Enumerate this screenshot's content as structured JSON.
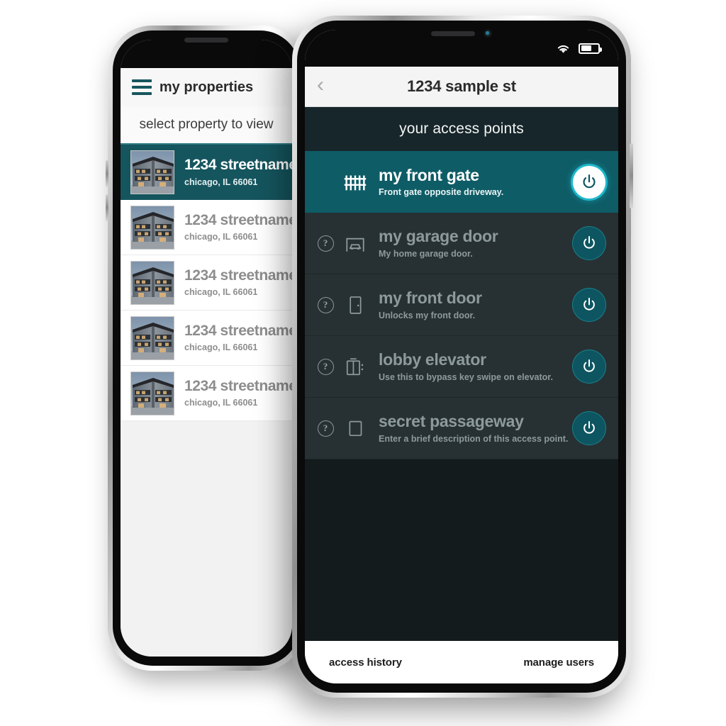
{
  "front_phone": {
    "status_bar": {
      "wifi_icon": "wifi-icon",
      "battery_icon": "battery-icon",
      "battery_percent": 65
    },
    "nav": {
      "back_icon": "chevron-left-icon",
      "title": "1234 sample st"
    },
    "subheader": "your access points",
    "access_points": [
      {
        "name": "my front gate",
        "description": "Front gate opposite driveway.",
        "icon": "gate-fence-icon",
        "active": true,
        "has_help": false,
        "power_icon": "power-icon",
        "power_on": true
      },
      {
        "name": "my garage door",
        "description": "My home garage door.",
        "icon": "garage-door-icon",
        "active": false,
        "has_help": true,
        "help_icon": "question-mark-icon",
        "power_icon": "power-icon",
        "power_on": false
      },
      {
        "name": "my front door",
        "description": "Unlocks my front door.",
        "icon": "door-icon",
        "active": false,
        "has_help": true,
        "help_icon": "question-mark-icon",
        "power_icon": "power-icon",
        "power_on": false
      },
      {
        "name": "lobby elevator",
        "description": "Use this to bypass key swipe on elevator.",
        "icon": "elevator-icon",
        "active": false,
        "has_help": true,
        "help_icon": "question-mark-icon",
        "power_icon": "power-icon",
        "power_on": false
      },
      {
        "name": "secret passageway",
        "description": "Enter a brief description of this access point.",
        "icon": "blank-square-icon",
        "active": false,
        "has_help": true,
        "help_icon": "question-mark-icon",
        "power_icon": "power-icon",
        "power_on": false
      }
    ],
    "tabbar": {
      "left": "access history",
      "right": "manage users"
    }
  },
  "back_phone": {
    "menu_icon": "hamburger-menu-icon",
    "title": "my properties",
    "subheader": "select property to view",
    "properties": [
      {
        "name": "1234 streetname",
        "address": "chicago, IL 66061",
        "active": true,
        "thumb": "building-photo"
      },
      {
        "name": "1234 streetname",
        "address": "chicago, IL 66061",
        "active": false,
        "thumb": "building-photo"
      },
      {
        "name": "1234 streetname",
        "address": "chicago, IL 66061",
        "active": false,
        "thumb": "building-photo"
      },
      {
        "name": "1234 streetname",
        "address": "chicago, IL 66061",
        "active": false,
        "thumb": "building-photo"
      },
      {
        "name": "1234 streetname",
        "address": "chicago, IL 66061",
        "active": false,
        "thumb": "building-photo"
      }
    ]
  },
  "colors": {
    "accent_teal": "#0e5c66",
    "dark_header": "#16262a",
    "row_dark": "#273133",
    "page_dark": "#131b1d",
    "power_glow": "#1fb7cc",
    "muted_text": "#8d9a9c"
  }
}
